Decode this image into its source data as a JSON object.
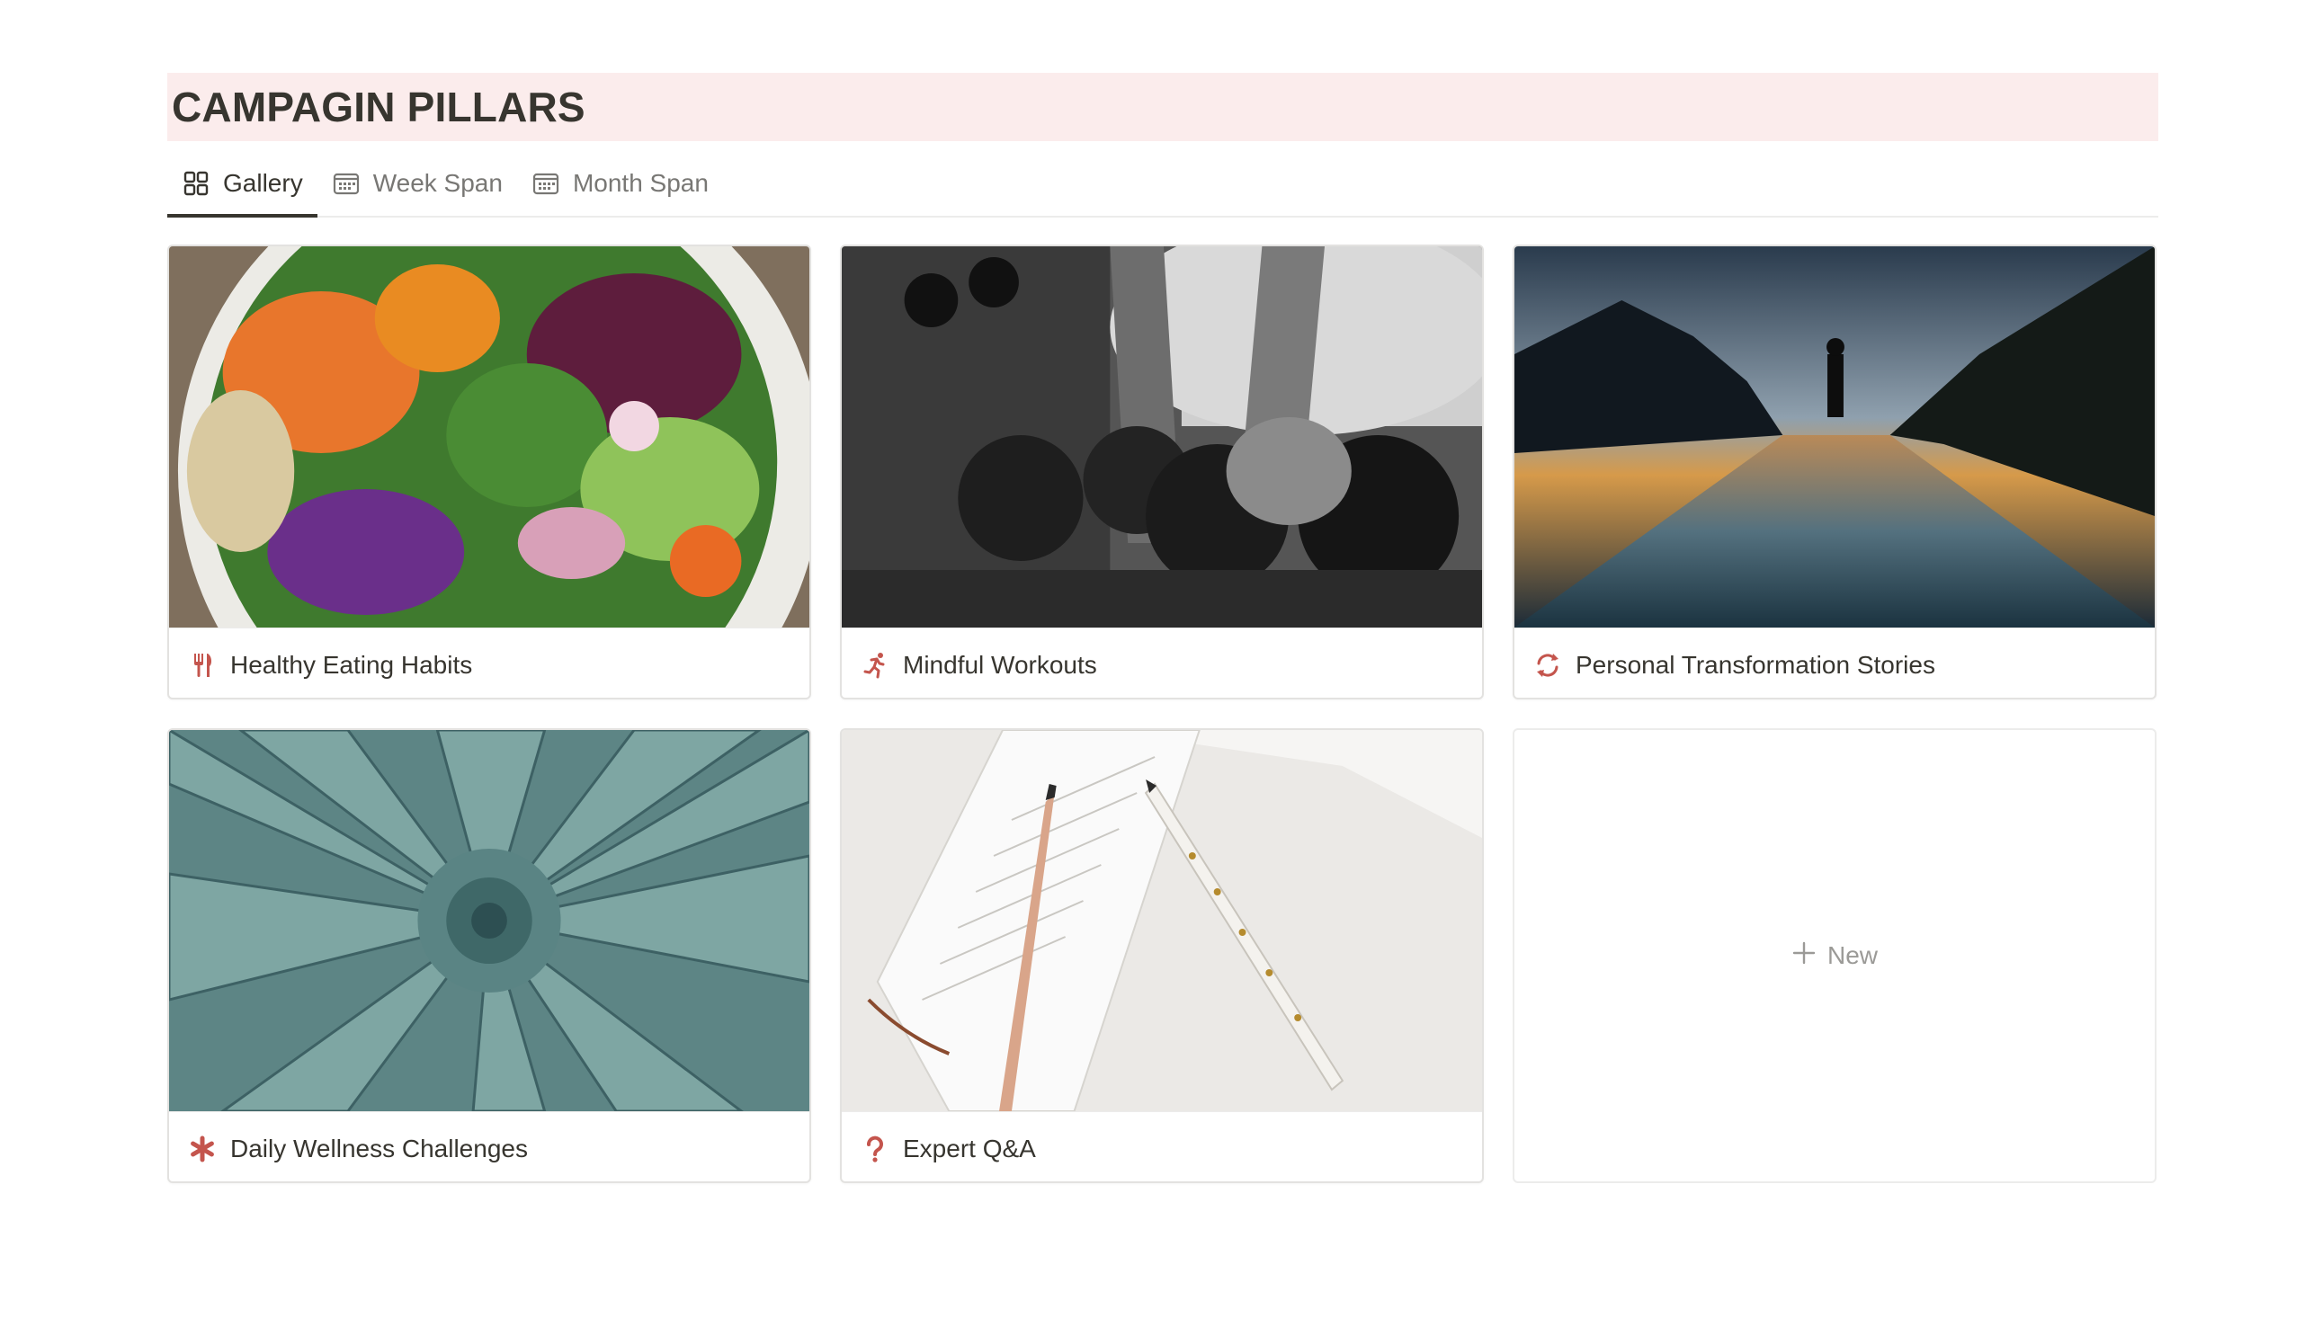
{
  "page": {
    "title": "CAMPAGIN PILLARS",
    "banner_color": "#fbecec"
  },
  "tabs": [
    {
      "label": "Gallery",
      "icon": "gallery-grid-icon",
      "active": true
    },
    {
      "label": "Week Span",
      "icon": "calendar-icon",
      "active": false
    },
    {
      "label": "Month Span",
      "icon": "calendar-icon",
      "active": false
    }
  ],
  "cards": [
    {
      "title": "Healthy Eating Habits",
      "icon": "fork-knife-icon",
      "cover": "salad bowl photo"
    },
    {
      "title": "Mindful Workouts",
      "icon": "running-person-icon",
      "cover": "dumbbell rack photo"
    },
    {
      "title": "Personal Transformation Stories",
      "icon": "refresh-arrows-icon",
      "cover": "runner on road at sunset photo"
    },
    {
      "title": "Daily Wellness Challenges",
      "icon": "asterisk-icon",
      "cover": "succulent plant photo"
    },
    {
      "title": "Expert Q&A",
      "icon": "question-mark-icon",
      "cover": "notebook and pens photo"
    }
  ],
  "new_card": {
    "label": "New",
    "icon": "plus-icon"
  },
  "colors": {
    "icon_accent": "#c4554d",
    "text": "#37352f",
    "muted": "#787774"
  }
}
